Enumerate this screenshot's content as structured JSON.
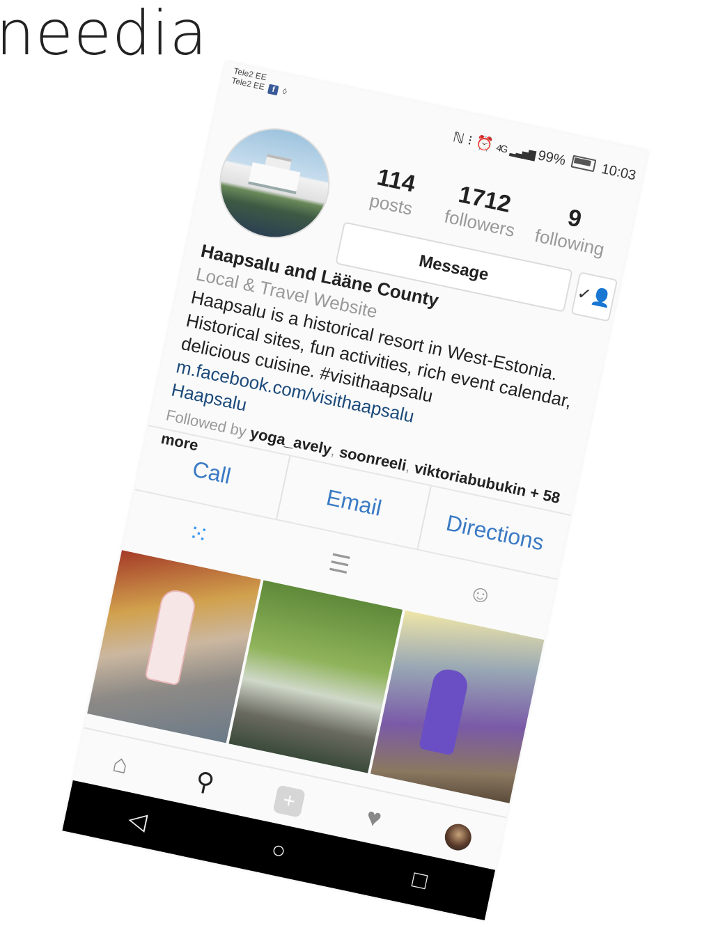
{
  "slide": {
    "title": "needia"
  },
  "status": {
    "carrier1": "Tele2 EE",
    "carrier2": "Tele2 EE",
    "fb_glyph": "f",
    "airbnb_glyph": "◊",
    "icons": "ℕ ⁝ ⏰",
    "net": "4G",
    "battery_pct": "99%",
    "time": "10:03"
  },
  "profile": {
    "stats": [
      {
        "num": "114",
        "label": "posts"
      },
      {
        "num": "1712",
        "label": "followers"
      },
      {
        "num": "9",
        "label": "following"
      }
    ],
    "message_label": "Message",
    "follow_icon": "✓👤",
    "name": "Haapsalu and Lääne County",
    "category": "Local & Travel Website",
    "bio_lines": [
      "Haapsalu is a historical resort in West-Estonia.",
      "Historical sites, fun activities, rich event calendar,",
      "delicious cuisine. #visithaapsalu"
    ],
    "link": "m.facebook.com/visithaapsalu",
    "location": "Haapsalu",
    "followed_by_prefix": "Followed by",
    "followed_users": [
      "yoga_avely",
      "soonreeli",
      "viktoriabubukin"
    ],
    "followed_more": "+ 58 more"
  },
  "actions": [
    "Call",
    "Email",
    "Directions"
  ],
  "tabs": {
    "grid": "⁙",
    "list": "☰",
    "tagged": "☺"
  },
  "nav": {
    "home": "⌂",
    "search": "⚲",
    "add": "+",
    "heart": "♥"
  },
  "system_keys": {
    "back": "◁",
    "home": "○",
    "recent": "□"
  },
  "colors": {
    "accent": "#3897f0",
    "link": "#1c4a7a",
    "action_blue": "#3a7ac4"
  }
}
